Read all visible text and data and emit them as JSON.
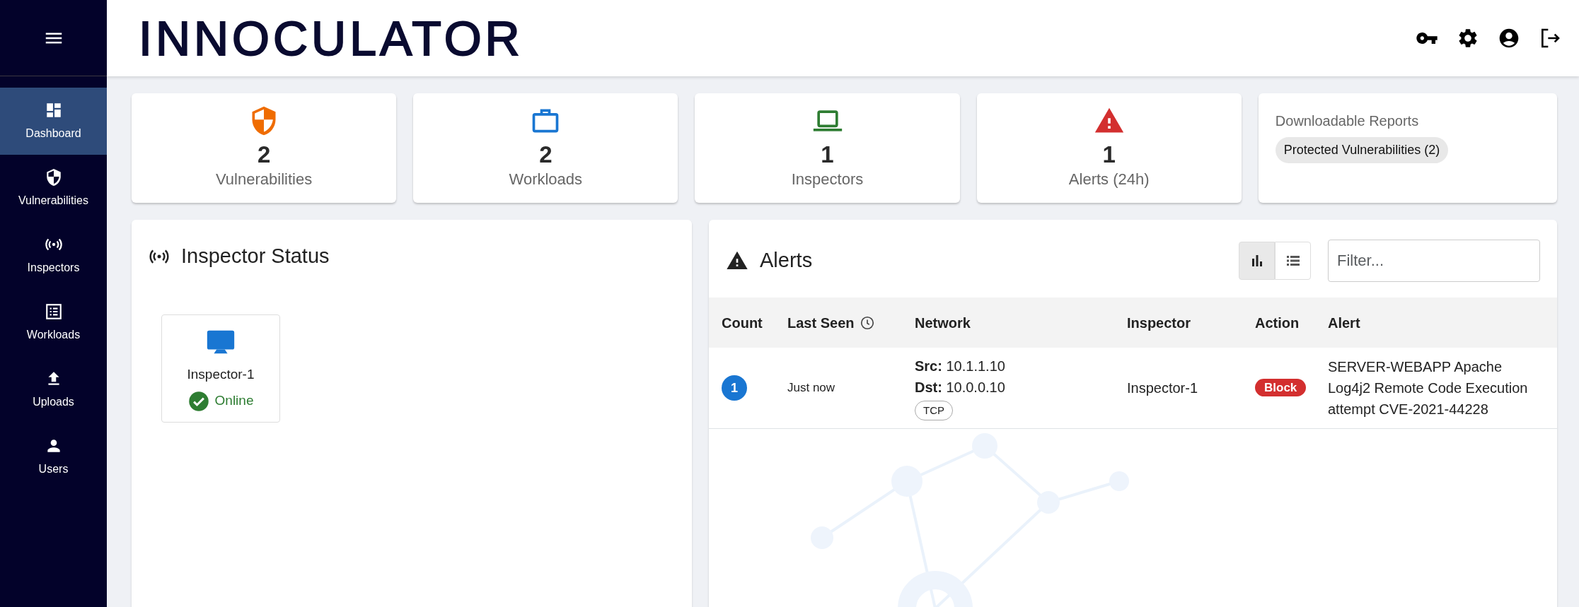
{
  "sidebar": {
    "items": [
      {
        "label": "Dashboard",
        "selected": true
      },
      {
        "label": "Vulnerabilities",
        "selected": false
      },
      {
        "label": "Inspectors",
        "selected": false
      },
      {
        "label": "Workloads",
        "selected": false
      },
      {
        "label": "Uploads",
        "selected": false
      },
      {
        "label": "Users",
        "selected": false
      }
    ]
  },
  "header": {
    "logo": "INNOCULATOR"
  },
  "stats": [
    {
      "value": "2",
      "label": "Vulnerabilities"
    },
    {
      "value": "2",
      "label": "Workloads"
    },
    {
      "value": "1",
      "label": "Inspectors"
    },
    {
      "value": "1",
      "label": "Alerts (24h)"
    }
  ],
  "reports": {
    "title": "Downloadable Reports",
    "chips": [
      "Protected Vulnerabilities (2)"
    ]
  },
  "inspector_status": {
    "title": "Inspector Status",
    "inspectors": [
      {
        "name": "Inspector-1",
        "status": "Online",
        "online": true
      }
    ]
  },
  "alerts": {
    "title": "Alerts",
    "view_toggle": [
      {
        "selected": true
      },
      {
        "selected": false
      }
    ],
    "filter": {
      "placeholder": "Filter..."
    },
    "table": {
      "columns": [
        "Count",
        "Last Seen",
        "Network",
        "Inspector",
        "Action",
        "Alert"
      ],
      "rows": [
        {
          "count": "1",
          "last_seen": "Just now",
          "src": "**Src:** 10.1.1.10",
          "dst": "**Dst:** 10.0.0.10",
          "protocol": "TCP",
          "inspector": "Inspector-1",
          "action": "Block",
          "alert": "SERVER-WEBAPP Apache Log4j2 Remote Code Execution attempt CVE-2021-44228"
        }
      ]
    }
  }
}
